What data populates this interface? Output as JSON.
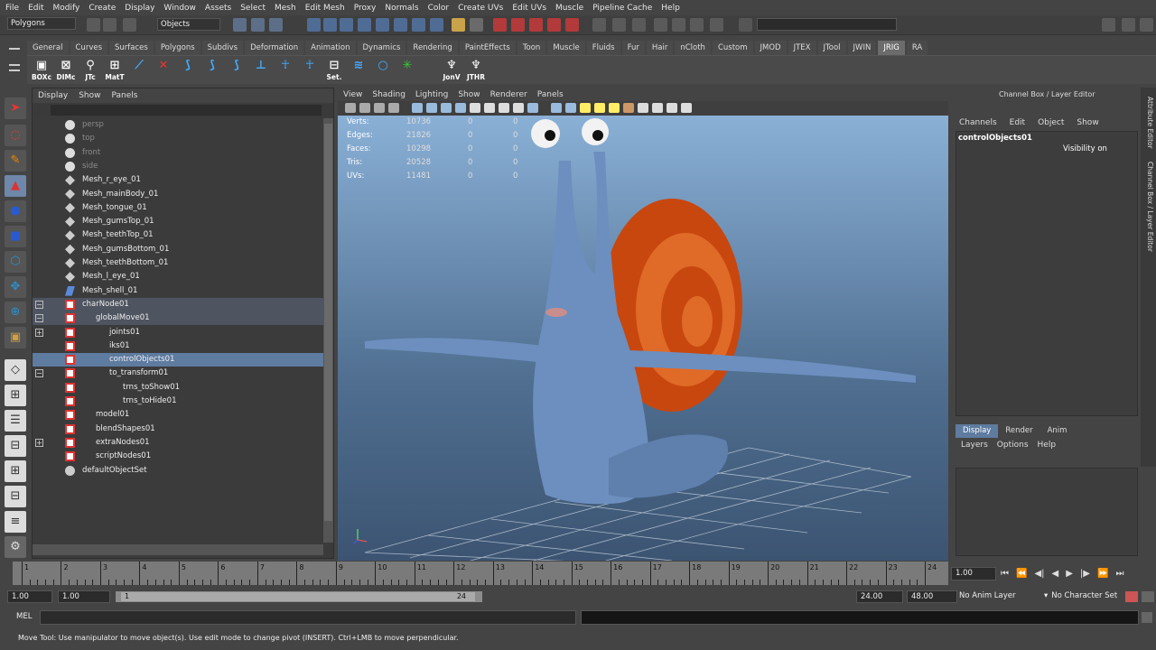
{
  "menubar": [
    "File",
    "Edit",
    "Modify",
    "Create",
    "Display",
    "Window",
    "Assets",
    "Select",
    "Mesh",
    "Edit Mesh",
    "Proxy",
    "Normals",
    "Color",
    "Create UVs",
    "Edit UVs",
    "Muscle",
    "Pipeline Cache",
    "Help"
  ],
  "status": {
    "mode": "Polygons",
    "selection_mask": "Objects"
  },
  "shelf_tabs": [
    "General",
    "Curves",
    "Surfaces",
    "Polygons",
    "Subdivs",
    "Deformation",
    "Animation",
    "Dynamics",
    "Rendering",
    "PaintEffects",
    "Toon",
    "Muscle",
    "Fluids",
    "Fur",
    "Hair",
    "nCloth",
    "Custom",
    "JMOD",
    "JTEX",
    "JTool",
    "JWIN",
    "JRIG",
    "RA"
  ],
  "active_shelf_tab": "JRIG",
  "shelf_icons": [
    {
      "label": "BOXc",
      "icon": "box-icon"
    },
    {
      "label": "DIMc",
      "icon": "dim-icon"
    },
    {
      "label": "JTc",
      "icon": "jtc-icon"
    },
    {
      "label": "MatT",
      "icon": "matrix-icon"
    },
    {
      "label": "",
      "icon": "joint-icon"
    },
    {
      "label": "",
      "icon": "joint-x-icon"
    },
    {
      "label": "",
      "icon": "chain-icon"
    },
    {
      "label": "",
      "icon": "chain-icon"
    },
    {
      "label": "",
      "icon": "chain-icon"
    },
    {
      "label": "",
      "icon": "axis-icon"
    },
    {
      "label": "",
      "icon": "skeleton-icon"
    },
    {
      "label": "",
      "icon": "skeleton-icon"
    },
    {
      "label": "Set.",
      "icon": "set-icon"
    },
    {
      "label": "",
      "icon": "wave-icon"
    },
    {
      "label": "",
      "icon": "circle-icon"
    },
    {
      "label": "",
      "icon": "star-icon"
    },
    {
      "label": "JonV",
      "icon": "jonv-icon"
    },
    {
      "label": "JTHR",
      "icon": "jthr-icon"
    }
  ],
  "outliner": {
    "menu": [
      "Display",
      "Show",
      "Panels"
    ],
    "rows": [
      {
        "label": "persp",
        "indent": 0,
        "type": "camera",
        "expander": ""
      },
      {
        "label": "top",
        "indent": 0,
        "type": "camera",
        "expander": ""
      },
      {
        "label": "front",
        "indent": 0,
        "type": "camera",
        "expander": ""
      },
      {
        "label": "side",
        "indent": 0,
        "type": "camera",
        "expander": ""
      },
      {
        "label": "Mesh_r_eye_01",
        "indent": 0,
        "type": "mesh",
        "expander": ""
      },
      {
        "label": "Mesh_mainBody_01",
        "indent": 0,
        "type": "mesh",
        "expander": ""
      },
      {
        "label": "Mesh_tongue_01",
        "indent": 0,
        "type": "mesh",
        "expander": ""
      },
      {
        "label": "Mesh_gumsTop_01",
        "indent": 0,
        "type": "mesh",
        "expander": ""
      },
      {
        "label": "Mesh_teethTop_01",
        "indent": 0,
        "type": "mesh",
        "expander": ""
      },
      {
        "label": "Mesh_gumsBottom_01",
        "indent": 0,
        "type": "mesh",
        "expander": ""
      },
      {
        "label": "Mesh_teethBottom_01",
        "indent": 0,
        "type": "mesh",
        "expander": ""
      },
      {
        "label": "Mesh_l_eye_01",
        "indent": 0,
        "type": "mesh",
        "expander": ""
      },
      {
        "label": "Mesh_shell_01",
        "indent": 0,
        "type": "shell",
        "expander": ""
      },
      {
        "label": "charNode01",
        "indent": 0,
        "type": "transform",
        "expander": "−",
        "state": "hl"
      },
      {
        "label": "globalMove01",
        "indent": 1,
        "type": "transform",
        "expander": "−",
        "state": "hl"
      },
      {
        "label": "joints01",
        "indent": 2,
        "type": "transform",
        "expander": "+"
      },
      {
        "label": "iks01",
        "indent": 2,
        "type": "transform",
        "expander": ""
      },
      {
        "label": "controlObjects01",
        "indent": 2,
        "type": "transform",
        "expander": "",
        "state": "sel"
      },
      {
        "label": "to_transform01",
        "indent": 2,
        "type": "transform",
        "expander": "−"
      },
      {
        "label": "trns_toShow01",
        "indent": 3,
        "type": "transform",
        "expander": ""
      },
      {
        "label": "trns_toHide01",
        "indent": 3,
        "type": "transform",
        "expander": ""
      },
      {
        "label": "model01",
        "indent": 1,
        "type": "transform",
        "expander": ""
      },
      {
        "label": "blendShapes01",
        "indent": 1,
        "type": "transform",
        "expander": ""
      },
      {
        "label": "extraNodes01",
        "indent": 1,
        "type": "transform",
        "expander": "+"
      },
      {
        "label": "scriptNodes01",
        "indent": 1,
        "type": "transform",
        "expander": ""
      },
      {
        "label": "defaultObjectSet",
        "indent": 0,
        "type": "set",
        "expander": ""
      }
    ]
  },
  "viewport": {
    "menu": [
      "View",
      "Shading",
      "Lighting",
      "Show",
      "Renderer",
      "Panels"
    ],
    "hud": [
      {
        "k": "Verts:",
        "v1": "10736",
        "v2": "0",
        "v3": "0"
      },
      {
        "k": "Edges:",
        "v1": "21826",
        "v2": "0",
        "v3": "0"
      },
      {
        "k": "Faces:",
        "v1": "10298",
        "v2": "0",
        "v3": "0"
      },
      {
        "k": "Tris:",
        "v1": "20528",
        "v2": "0",
        "v3": "0"
      },
      {
        "k": "UVs:",
        "v1": "11481",
        "v2": "0",
        "v3": "0"
      }
    ]
  },
  "channel_box": {
    "title": "Channel Box / Layer Editor",
    "menu": [
      "Channels",
      "Edit",
      "Object",
      "Show"
    ],
    "object": "controlObjects01",
    "attr": "Visibility",
    "attr_value": "on",
    "layer_tabs": [
      "Display",
      "Render",
      "Anim"
    ],
    "active_layer_tab": "Display",
    "layer_menu": [
      "Layers",
      "Options",
      "Help"
    ],
    "side_tabs": [
      "Attribute Editor",
      "Channel Box / Layer Editor"
    ]
  },
  "timeline": {
    "ticks": [
      "1",
      "2",
      "3",
      "4",
      "5",
      "6",
      "7",
      "8",
      "9",
      "10",
      "11",
      "12",
      "13",
      "14",
      "15",
      "16",
      "17",
      "18",
      "19",
      "20",
      "21",
      "22",
      "23",
      "24"
    ],
    "current_frame": "1.00",
    "range_start": "1.00",
    "playback_start": "1.00",
    "range_thumb_start": "1",
    "range_thumb_end": "24",
    "playback_end": "24.00",
    "range_end": "48.00",
    "anim_layer": "No Anim Layer",
    "char_set": "No Character Set"
  },
  "mel_label": "MEL",
  "help_line": "Move Tool: Use manipulator to move object(s). Use edit mode to change pivot (INSERT).  Ctrl+LMB to move perpendicular.",
  "colors": {
    "selection": "#5e7ba0",
    "shell": "#d2531a",
    "snail_body": "#6c8fbf"
  }
}
